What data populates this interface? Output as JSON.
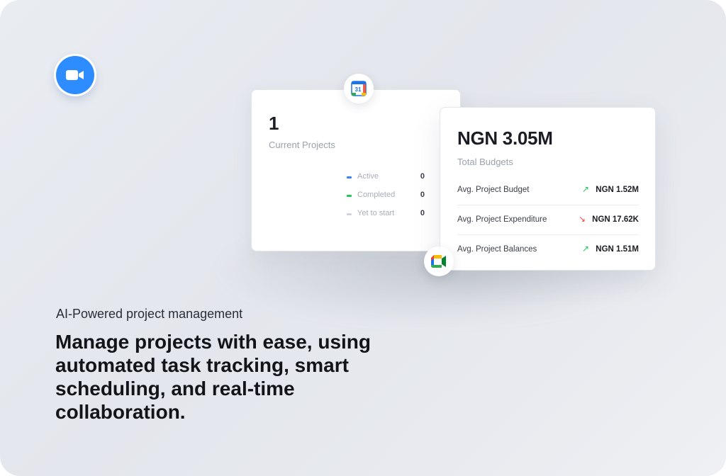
{
  "hero": {
    "eyebrow": "AI-Powered project management",
    "headline": "Manage projects with ease, using automated task tracking, smart scheduling, and real-time collaboration."
  },
  "icons": {
    "top_left": "zoom-video-icon",
    "calendar": "google-calendar-icon",
    "meet": "google-meet-icon",
    "calendar_day": "31"
  },
  "projects_card": {
    "count": "1",
    "label": "Current Projects",
    "legend": [
      {
        "label": "Active",
        "value": "0",
        "color": "#3b82f6"
      },
      {
        "label": "Completed",
        "value": "0",
        "color": "#22c55e"
      },
      {
        "label": "Yet to start",
        "value": "0",
        "color": "#d1d5db"
      }
    ]
  },
  "budget_card": {
    "total": "NGN 3.05M",
    "label": "Total Budgets",
    "metrics": [
      {
        "label": "Avg. Project Budget",
        "value": "NGN 1.52M",
        "trend": "up",
        "arrow": "↗",
        "color": "#22c55e"
      },
      {
        "label": "Avg. Project Expenditure",
        "value": "NGN 17.62K",
        "trend": "down",
        "arrow": "↘",
        "color": "#ef4444"
      },
      {
        "label": "Avg. Project Balances",
        "value": "NGN 1.51M",
        "trend": "up",
        "arrow": "↗",
        "color": "#22c55e"
      }
    ]
  }
}
